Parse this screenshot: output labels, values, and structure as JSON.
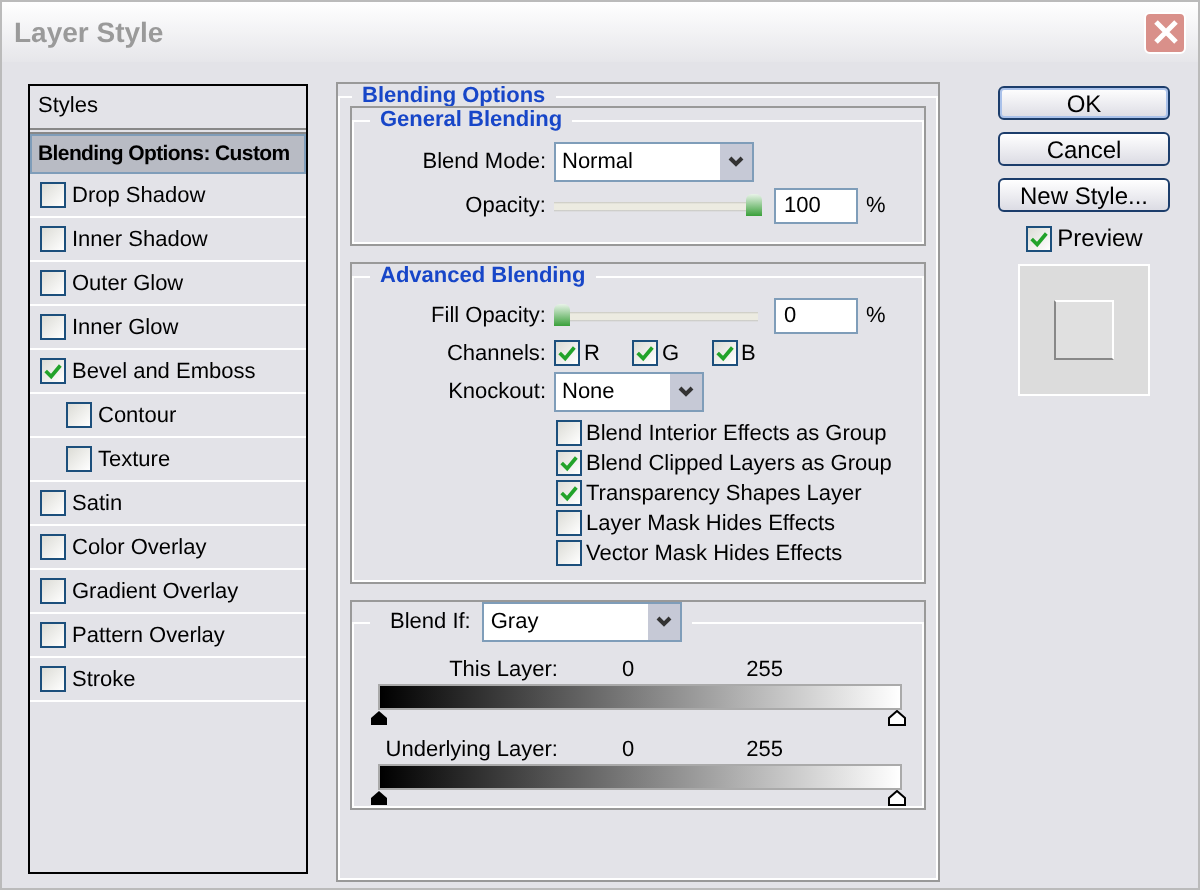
{
  "window": {
    "title": "Layer Style"
  },
  "styles": {
    "header": "Styles",
    "items": [
      {
        "label": "Blending Options: Custom",
        "kind": "heading",
        "selected": true
      },
      {
        "label": "Drop Shadow",
        "kind": "check",
        "checked": false,
        "indented": false
      },
      {
        "label": "Inner Shadow",
        "kind": "check",
        "checked": false,
        "indented": false
      },
      {
        "label": "Outer Glow",
        "kind": "check",
        "checked": false,
        "indented": false
      },
      {
        "label": "Inner Glow",
        "kind": "check",
        "checked": false,
        "indented": false
      },
      {
        "label": "Bevel and Emboss",
        "kind": "check",
        "checked": true,
        "indented": false
      },
      {
        "label": "Contour",
        "kind": "check",
        "checked": false,
        "indented": true
      },
      {
        "label": "Texture",
        "kind": "check",
        "checked": false,
        "indented": true
      },
      {
        "label": "Satin",
        "kind": "check",
        "checked": false,
        "indented": false
      },
      {
        "label": "Color Overlay",
        "kind": "check",
        "checked": false,
        "indented": false
      },
      {
        "label": "Gradient Overlay",
        "kind": "check",
        "checked": false,
        "indented": false
      },
      {
        "label": "Pattern Overlay",
        "kind": "check",
        "checked": false,
        "indented": false
      },
      {
        "label": "Stroke",
        "kind": "check",
        "checked": false,
        "indented": false
      }
    ]
  },
  "blending": {
    "title": "Blending Options",
    "general": {
      "title": "General Blending",
      "blend_mode_label": "Blend Mode:",
      "blend_mode": "Normal",
      "opacity_label": "Opacity:",
      "opacity": {
        "level": 1,
        "value": "100",
        "unit": "%"
      }
    },
    "advanced": {
      "title": "Advanced Blending",
      "fill_label": "Fill Opacity:",
      "fill": {
        "level": 0,
        "value": "0",
        "unit": "%"
      },
      "channels_label": "Channels:",
      "channels": [
        {
          "label": "R",
          "checked": true
        },
        {
          "label": "G",
          "checked": true
        },
        {
          "label": "B",
          "checked": true
        }
      ],
      "knockout_label": "Knockout:",
      "knockout": "None",
      "options": [
        {
          "label": "Blend Interior Effects as Group",
          "checked": false
        },
        {
          "label": "Blend Clipped Layers as Group",
          "checked": true
        },
        {
          "label": "Transparency Shapes Layer",
          "checked": true
        },
        {
          "label": "Layer Mask Hides Effects",
          "checked": false
        },
        {
          "label": "Vector Mask Hides Effects",
          "checked": false
        }
      ]
    },
    "blend_if": {
      "label": "Blend If:",
      "value": "Gray",
      "ranges": [
        {
          "label": "This Layer:",
          "low": "0",
          "high": "255"
        },
        {
          "label": "Underlying Layer:",
          "low": "0",
          "high": "255"
        }
      ]
    }
  },
  "buttons": [
    {
      "label": "OK",
      "default": true
    },
    {
      "label": "Cancel",
      "default": false
    },
    {
      "label": "New Style...",
      "default": false
    }
  ],
  "preview": {
    "label": "Preview",
    "checked": true
  }
}
